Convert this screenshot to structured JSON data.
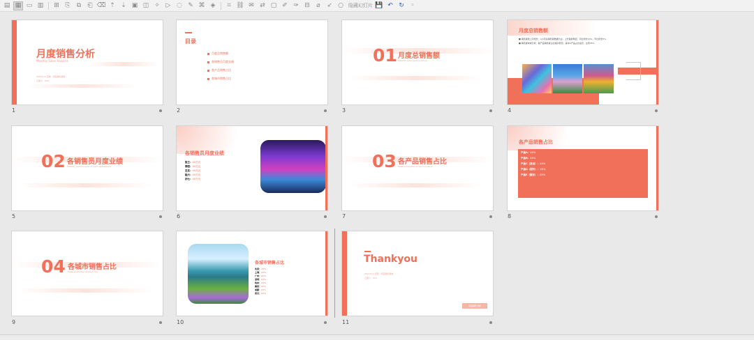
{
  "toolbar": {
    "hidden_label": "隐藏幻灯片",
    "icons": [
      "normal-view-icon",
      "slide-sorter-icon",
      "notes-view-icon",
      "outline-view-icon",
      "new-slide-icon",
      "copy-icon",
      "paste-icon",
      "undo-icon",
      "redo-icon",
      "save-icon"
    ]
  },
  "slides": [
    {
      "number": "1",
      "title": "月度销售分析",
      "subtitle": "Monthly Sales Analysis",
      "meta1": "2023/1/1 日期 · 月度销售报告",
      "meta2": "汇报人：XXX"
    },
    {
      "number": "2",
      "heading": "目录",
      "items": [
        "月度总销售额",
        "各销售员月度业绩",
        "各产品销售占比",
        "各城市销售占比"
      ]
    },
    {
      "number": "3",
      "big": "01",
      "title": "月度总销售额",
      "sub": "Monthly total sales revenue"
    },
    {
      "number": "4",
      "title": "月度总销售额",
      "line1": "■ 销售额较上月增长：以4月总销售额数据为主，上升趋势明显，同比增长10%，环比增长5%",
      "line2": "■ 销售额构成分析：各产品销售额占比相对稳定，其中A产品占比最高，达到35%"
    },
    {
      "number": "5",
      "big": "02",
      "title": "各销售员月度业绩",
      "sub": "Monthly performance of each salesperson"
    },
    {
      "number": "6",
      "title": "各销售员月度业绩",
      "rows": [
        [
          "张三：",
          "XX万元"
        ],
        [
          "李四：",
          "XX万元"
        ],
        [
          "王五：",
          "XX万元"
        ],
        [
          "赵六：",
          "XX万元"
        ],
        [
          "孙七：",
          "XX万元"
        ]
      ]
    },
    {
      "number": "7",
      "big": "03",
      "title": "各产品销售占比",
      "sub": "Sales proportion of each product"
    },
    {
      "number": "8",
      "title": "各产品销售占比",
      "rows": [
        [
          "产品A：",
          "XX%"
        ],
        [
          "产品B：",
          "XX%"
        ],
        [
          "产品C（其他）：",
          "XX%"
        ],
        [
          "产品D（配件）：",
          "XX%"
        ],
        [
          "产品E（服务）：",
          "XX%"
        ]
      ]
    },
    {
      "number": "9",
      "big": "04",
      "title": "各城市销售占比",
      "sub": "Sales proportion of each city"
    },
    {
      "number": "10",
      "title": "各城市销售占比",
      "rows": [
        [
          "北京：",
          "XX%"
        ],
        [
          "上海：",
          "XX%"
        ],
        [
          "广州：",
          "XX%"
        ],
        [
          "深圳：",
          "XX%"
        ],
        [
          "杭州：",
          "XX%"
        ],
        [
          "南京：",
          "XX%"
        ],
        [
          "成都：",
          "XX%"
        ],
        [
          "武汉：",
          "XX%"
        ]
      ]
    },
    {
      "number": "11",
      "title": "Thankyou",
      "meta1": "2023/1/1 日期 · 月度销售报告",
      "meta2": "汇报人：XXX",
      "button": "月度销售分析"
    }
  ],
  "colors": {
    "accent": "#f0705a",
    "background": "#e9e9e9"
  }
}
